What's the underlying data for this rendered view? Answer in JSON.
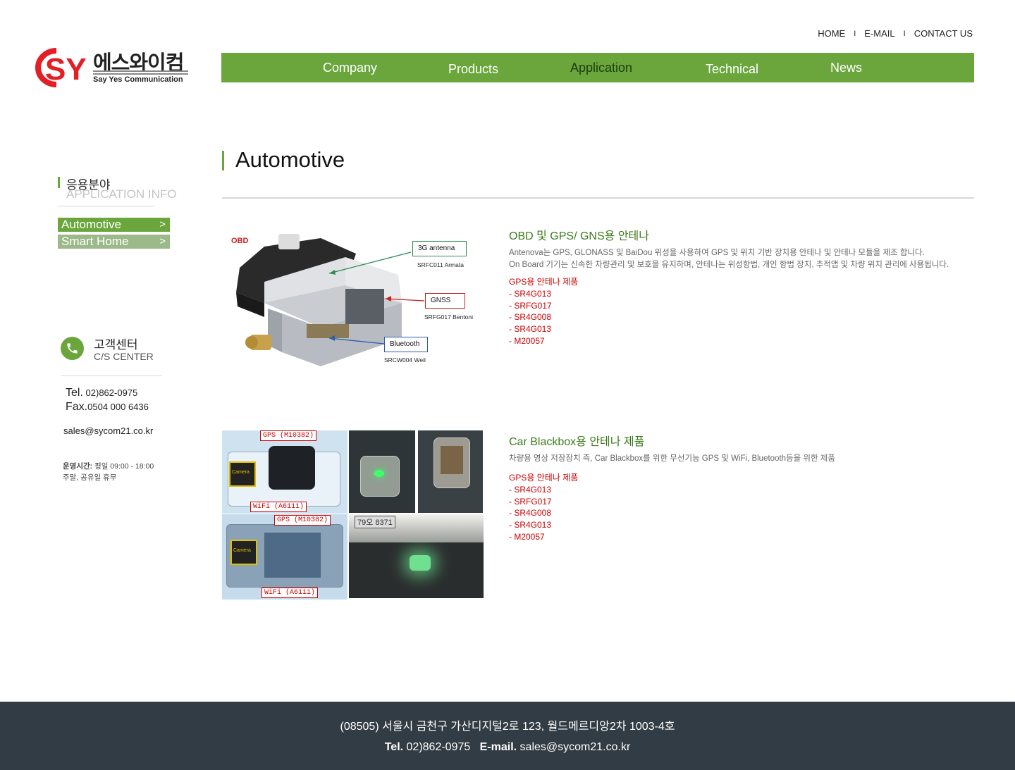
{
  "util_links": [
    "HOME",
    "E-MAIL",
    "CONTACT US"
  ],
  "util_sep": "I",
  "logo": {
    "mark": "SY",
    "ko": "에스와이컴",
    "en": "Say Yes Communication"
  },
  "nav": [
    "Company",
    "Products",
    "Application",
    "Technical",
    "News"
  ],
  "sidebar": {
    "title_ko": "응용분야",
    "title_en": "APPLICATION INFO",
    "menu": [
      "Automotive",
      "Smart Home"
    ],
    "chevron": ">"
  },
  "cs": {
    "title_ko": "고객센터",
    "title_en": "C/S CENTER",
    "tel_label": "Tel.",
    "tel": "02)862-0975",
    "fax_label": "Fax.",
    "fax": "0504 000 6436",
    "email": "sales@sycom21.co.kr",
    "hours_label": "운영시간:",
    "hours": "평일 09:00 - 18:00",
    "holiday": "주말, 공유일 휴무"
  },
  "page_title": "Automotive",
  "sections": [
    {
      "title": "OBD 및 GPS/ GNS용 안테나",
      "desc": [
        "Antenova는 GPS, GLONASS 및 BaiDou 위성을 사용하여 GPS 및 위치 기반 장치용 안테나 및 안테나 모듈을 제조 합니다.",
        "On Board 기기는 신속한 차량관리 및 보호을 유지하며, 안테나는 위성항법, 개인 항법 장치, 추적앱 및 차량 위치 관리에 사용됩니다."
      ],
      "products_head": "GPS용 안테나 제품",
      "products": [
        "- SR4G013",
        "- SRFG017",
        "- SR4G008",
        "- SR4G013",
        "- M20057"
      ]
    },
    {
      "title": "Car Blackbox용 안테나 제품",
      "desc": [
        "차량용 영상 저장장치 즉, Car Blackbox를 위한 무선기능 GPS 및 WiFi, Bluetooth등을 위한 제품"
      ],
      "products_head": "GPS용 안테나 제품",
      "products": [
        "- SR4G013",
        "- SRFG017",
        "- SR4G008",
        "- SR4G013",
        "- M20057"
      ]
    }
  ],
  "obd_figure": {
    "label": "OBD",
    "parts": [
      {
        "name": "3G antenna",
        "model": "SRFC011 Armata",
        "color": "#2e8b57"
      },
      {
        "name": "GNSS",
        "model": "SRFG017 Bentoni",
        "color": "#cc1f1f"
      },
      {
        "name": "Bluetooth",
        "model": "SRCW004 Weil",
        "color": "#2b5fa8"
      }
    ]
  },
  "photo_tags": [
    "GPS (M10382)",
    "WiFi (A6111)",
    "GPS (M10382)",
    "WiFi (A6111)",
    "Camera",
    "Camera",
    "79오 8371"
  ],
  "footer": {
    "address": "(08505) 서울시 금천구 가산디지털2로 123, 월드메르디앙2차 1003-4호",
    "tel_label": "Tel.",
    "tel": "02)862-0975",
    "email_label": "E-mail.",
    "email": "sales@sycom21.co.kr"
  },
  "colors": {
    "brand_green": "#6aa63c",
    "accent_red": "#cc0000",
    "footer_bg": "#323c44"
  }
}
